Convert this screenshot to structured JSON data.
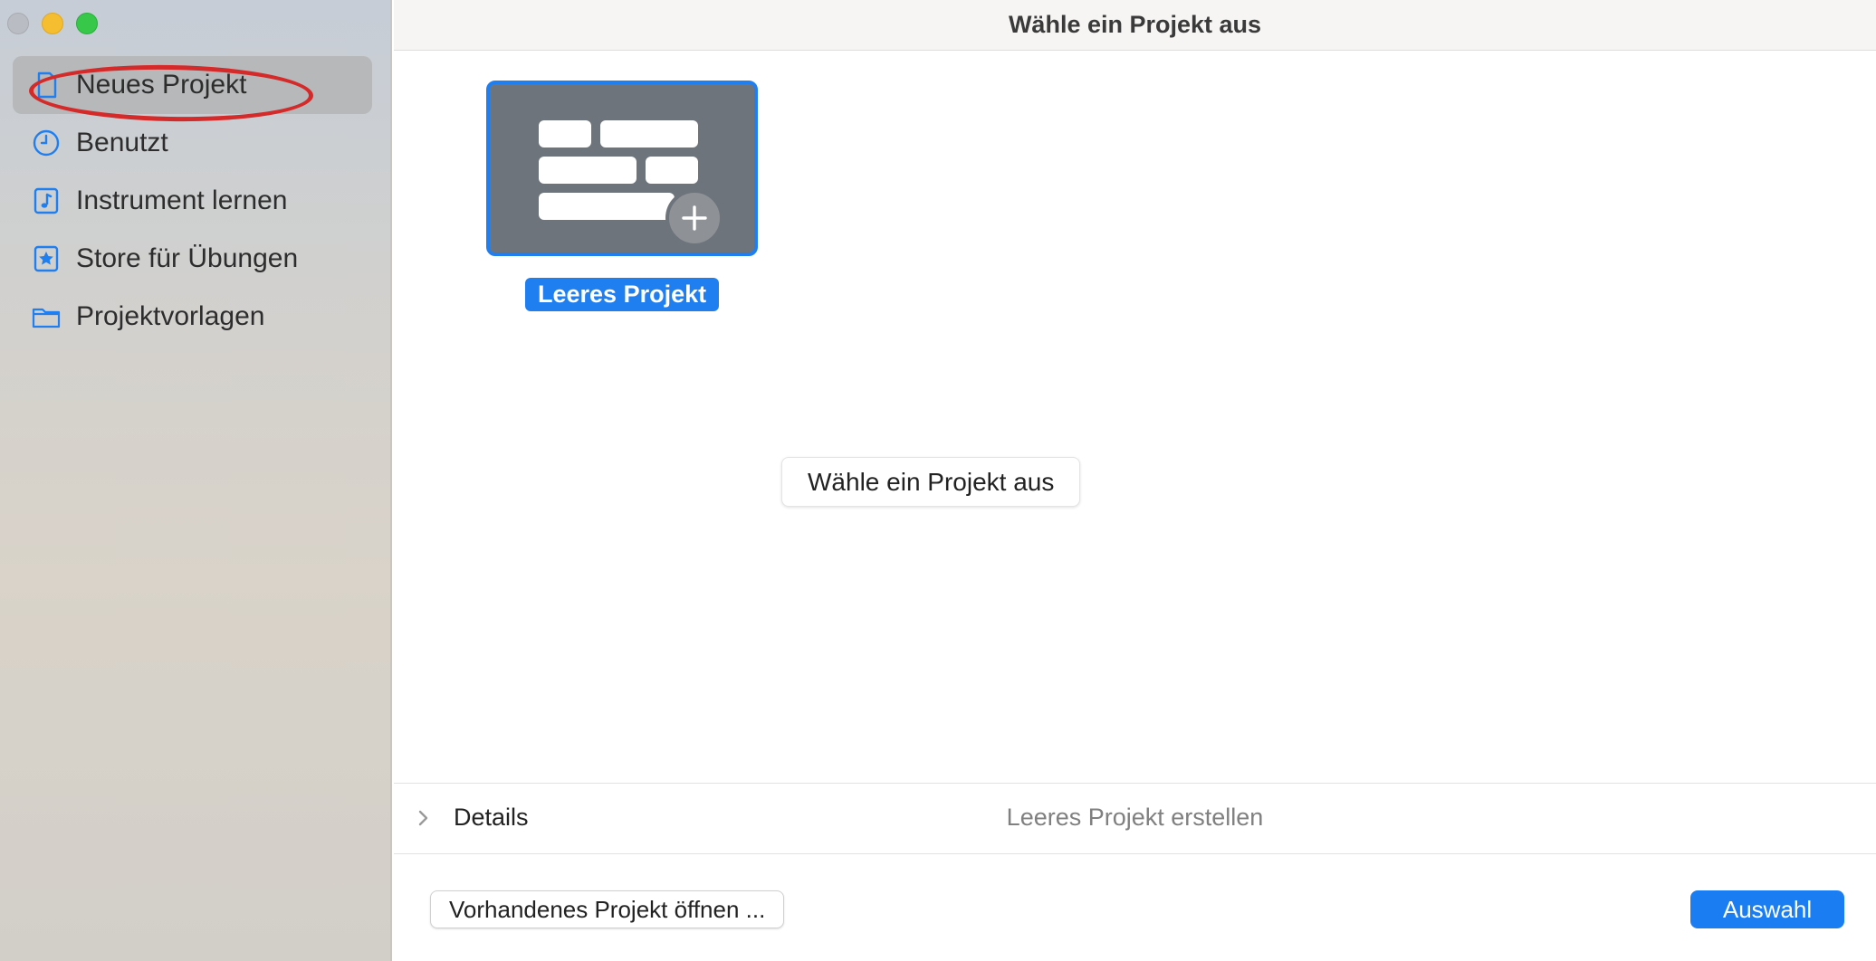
{
  "window": {
    "title": "Wähle ein Projekt aus"
  },
  "sidebar": {
    "items": [
      {
        "label": "Neues Projekt",
        "icon": "document-icon",
        "active": true
      },
      {
        "label": "Benutzt",
        "icon": "clock-icon"
      },
      {
        "label": "Instrument lernen",
        "icon": "music-note-icon"
      },
      {
        "label": "Store für Übungen",
        "icon": "star-icon"
      },
      {
        "label": "Projektvorlagen",
        "icon": "folder-icon"
      }
    ]
  },
  "main": {
    "template": {
      "label": "Leeres Projekt",
      "icon": "empty-project-icon"
    },
    "hint": "Wähle ein Projekt aus",
    "details": {
      "label": "Details",
      "description": "Leeres Projekt erstellen"
    },
    "buttons": {
      "open_existing": "Vorhandenes Projekt öffnen ...",
      "choose": "Auswahl"
    }
  },
  "colors": {
    "accent": "#1f7ff0",
    "annotation": "#d42a2a"
  }
}
